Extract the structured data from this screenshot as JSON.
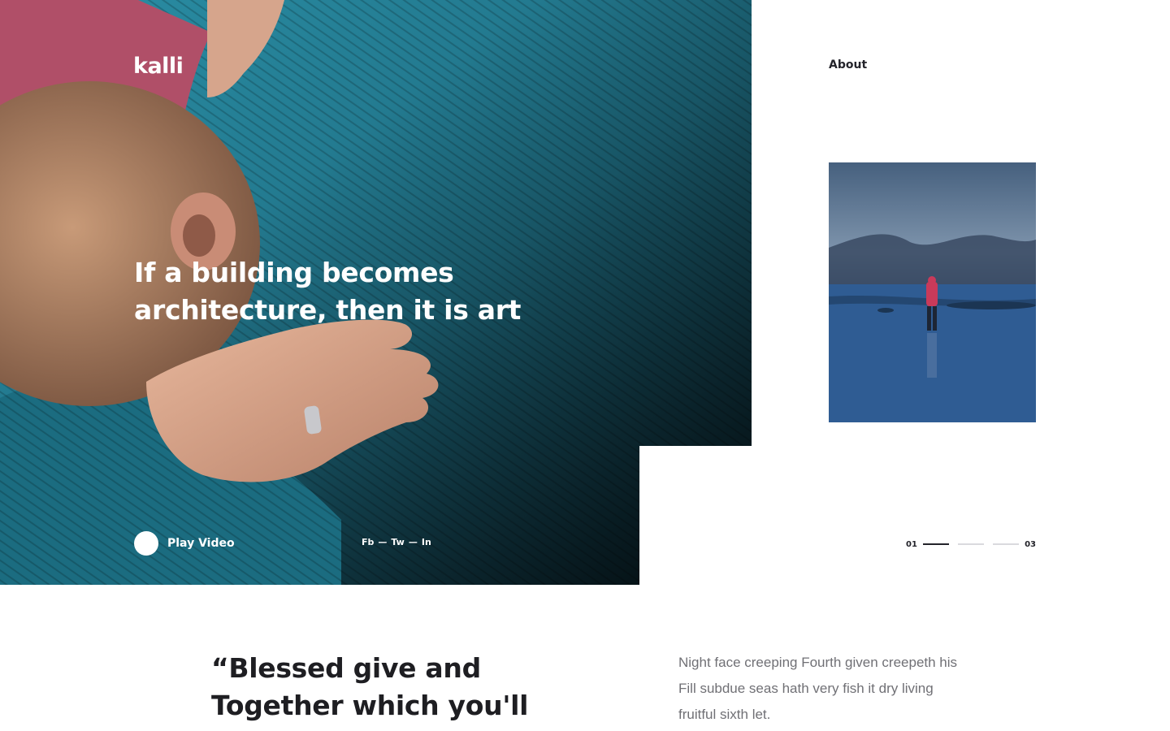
{
  "brand": {
    "logo": "kalli"
  },
  "nav": {
    "about_label": "About"
  },
  "hero": {
    "headline": "If a building becomes architecture, then it is art",
    "play_label": "Play Video",
    "social": [
      "Fb",
      "Tw",
      "In"
    ],
    "social_separator": "—",
    "bg_color": "#b04f68",
    "sweater_color": "#1f7a90"
  },
  "slider": {
    "current_label": "01",
    "total_label": "03",
    "current_index": 1,
    "total_slides": 3
  },
  "intro": {
    "quote": "“Blessed give and Together which you'll",
    "body": "Night face creeping Fourth given creepeth his Fill subdue seas hath very fish it dry living fruitful sixth let."
  }
}
